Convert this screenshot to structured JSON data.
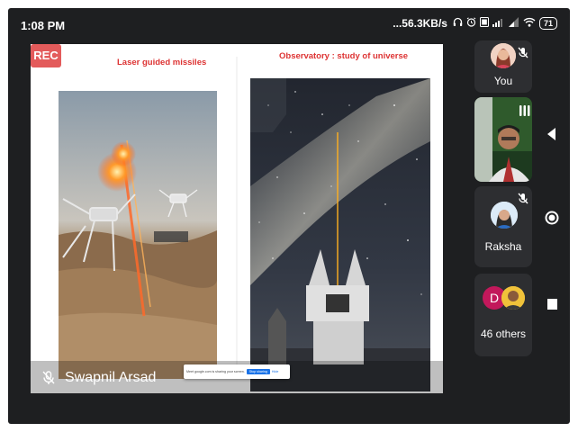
{
  "status_bar": {
    "time": "1:08 PM",
    "net_speed": "...56.3KB/s",
    "battery": "71"
  },
  "presentation": {
    "rec_label": "REC",
    "slide_title_left": "Laser guided missiles",
    "slide_title_right": "Observatory : study of universe",
    "presenter_name": "Swapnil Arsad",
    "share_toast": {
      "message": "Meet google.com is sharing your screen.",
      "stop_label": "Stop sharing",
      "hide_label": "Hide"
    }
  },
  "participants": {
    "you_label": "You",
    "raksha_label": "Raksha",
    "others_label": "46 others",
    "others_initial": "D"
  },
  "colors": {
    "frame_bg": "#1e1f21",
    "tile_bg": "#2d2e31",
    "rec_red": "#e35b5b",
    "slide_title_red": "#dd3333",
    "avatar_d": "#c2185b",
    "raksha_avatar_bg": "#e8f0fe"
  }
}
